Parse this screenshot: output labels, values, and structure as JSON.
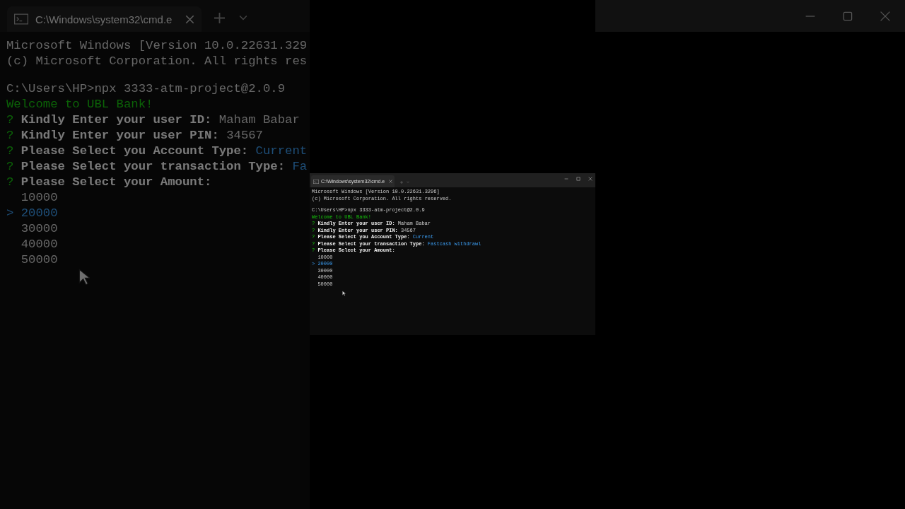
{
  "background_view": {
    "tab_title": "C:\\Windows\\system32\\cmd.e",
    "lines": [
      {
        "kind": "plain",
        "text": "Microsoft Windows [Version 10.0.22631.329"
      },
      {
        "kind": "plain",
        "text": "(c) Microsoft Corporation. All rights res"
      },
      {
        "kind": "blank"
      },
      {
        "kind": "plain",
        "text": "C:\\Users\\HP>npx 3333-atm-project@2.0.9"
      },
      {
        "kind": "success",
        "text": "Welcome to UBL Bank!"
      },
      {
        "kind": "prompt",
        "mark": "?",
        "text": "Kindly Enter your user ID:",
        "answer": "Maham Babar",
        "highlight": false
      },
      {
        "kind": "prompt",
        "mark": "?",
        "text": "Kindly Enter your user PIN:",
        "answer": "34567",
        "highlight": false
      },
      {
        "kind": "prompt",
        "mark": "?",
        "text": "Please Select you Account Type:",
        "answer": "Current",
        "highlight": true
      },
      {
        "kind": "prompt",
        "mark": "?",
        "text": "Please Select your transaction Type:",
        "answer": "Fa",
        "highlight": true
      },
      {
        "kind": "prompt",
        "mark": "?",
        "text": "Please Select your Amount:"
      }
    ],
    "pointer": ">",
    "options": [
      {
        "label": "10000",
        "selected": false
      },
      {
        "label": "20000",
        "selected": true
      },
      {
        "label": "30000",
        "selected": false
      },
      {
        "label": "40000",
        "selected": false
      },
      {
        "label": "50000",
        "selected": false
      }
    ]
  },
  "window": {
    "tab_title": "C:\\Windows\\system32\\cmd.e",
    "lines": [
      {
        "kind": "plain",
        "text": "Microsoft Windows [Version 10.0.22631.3296]"
      },
      {
        "kind": "plain",
        "text": "(c) Microsoft Corporation. All rights reserved."
      },
      {
        "kind": "blank"
      },
      {
        "kind": "plain",
        "text": "C:\\Users\\HP>npx 3333-atm-project@2.0.9"
      },
      {
        "kind": "success",
        "text": "Welcome to UBL Bank!"
      },
      {
        "kind": "prompt",
        "mark": "?",
        "text": "Kindly Enter your user ID:",
        "answer": "Maham Babar",
        "highlight": false
      },
      {
        "kind": "prompt",
        "mark": "?",
        "text": "Kindly Enter your user PIN:",
        "answer": "34567",
        "highlight": false
      },
      {
        "kind": "prompt",
        "mark": "?",
        "text": "Please Select you Account Type:",
        "answer": "Current",
        "highlight": true
      },
      {
        "kind": "prompt",
        "mark": "?",
        "text": "Please Select your transaction Type:",
        "answer": "Fastcash withdrawl",
        "highlight": true
      },
      {
        "kind": "prompt",
        "mark": "?",
        "text": "Please Select your Amount:"
      }
    ],
    "pointer": ">",
    "options": [
      {
        "label": "10000",
        "selected": false
      },
      {
        "label": "20000",
        "selected": true
      },
      {
        "label": "30000",
        "selected": false
      },
      {
        "label": "40000",
        "selected": false
      },
      {
        "label": "50000",
        "selected": false
      }
    ]
  }
}
